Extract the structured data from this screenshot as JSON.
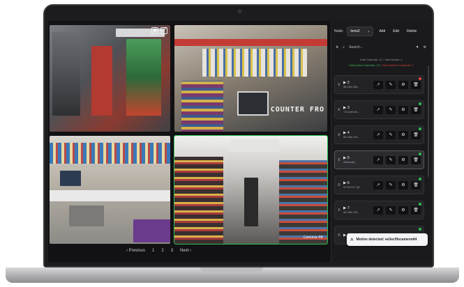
{
  "pagination": {
    "previous": "‹ Previous",
    "pages": [
      "1",
      "2",
      "3"
    ],
    "next": "Next ›"
  },
  "toolbar": {
    "node_label": "Node:",
    "node_value": "tvms2",
    "add": "Add",
    "edit": "Edit",
    "delete": "Delete"
  },
  "search": {
    "placeholder": "Search..."
  },
  "stats": {
    "total_cameras": "Total Cameras: 12",
    "total_nodes": "Total Nodes: 1",
    "total_active": "Total Active Cameras: 10",
    "total_inactive": "Total Inactive Cameras: 2"
  },
  "cameras": [
    {
      "number": "2",
      "ip": "58.150.253...",
      "status": "offline"
    },
    {
      "number": "3",
      "ip": "173.195.94...",
      "status": "online"
    },
    {
      "number": "4",
      "ip": "50.246.132...",
      "status": "online"
    },
    {
      "number": "5",
      "ip": "45secobj...",
      "status": "online"
    },
    {
      "number": "6",
      "ip": "47.94.217.18",
      "status": "online"
    },
    {
      "number": "7",
      "ip": "50.246.132...",
      "status": "online"
    },
    {
      "number": "8",
      "ip": "",
      "status": "online"
    }
  ],
  "feeds": {
    "cam4_overlay_text": "COUNTER FRO",
    "cam4_caption": "Camera 4ft"
  },
  "toast": {
    "message": "Motion detected: ee3ec0fscamerwit4"
  },
  "colors": {
    "active": "#2fbf55",
    "inactive": "#e0443b",
    "panel": "#1a1a1d"
  }
}
